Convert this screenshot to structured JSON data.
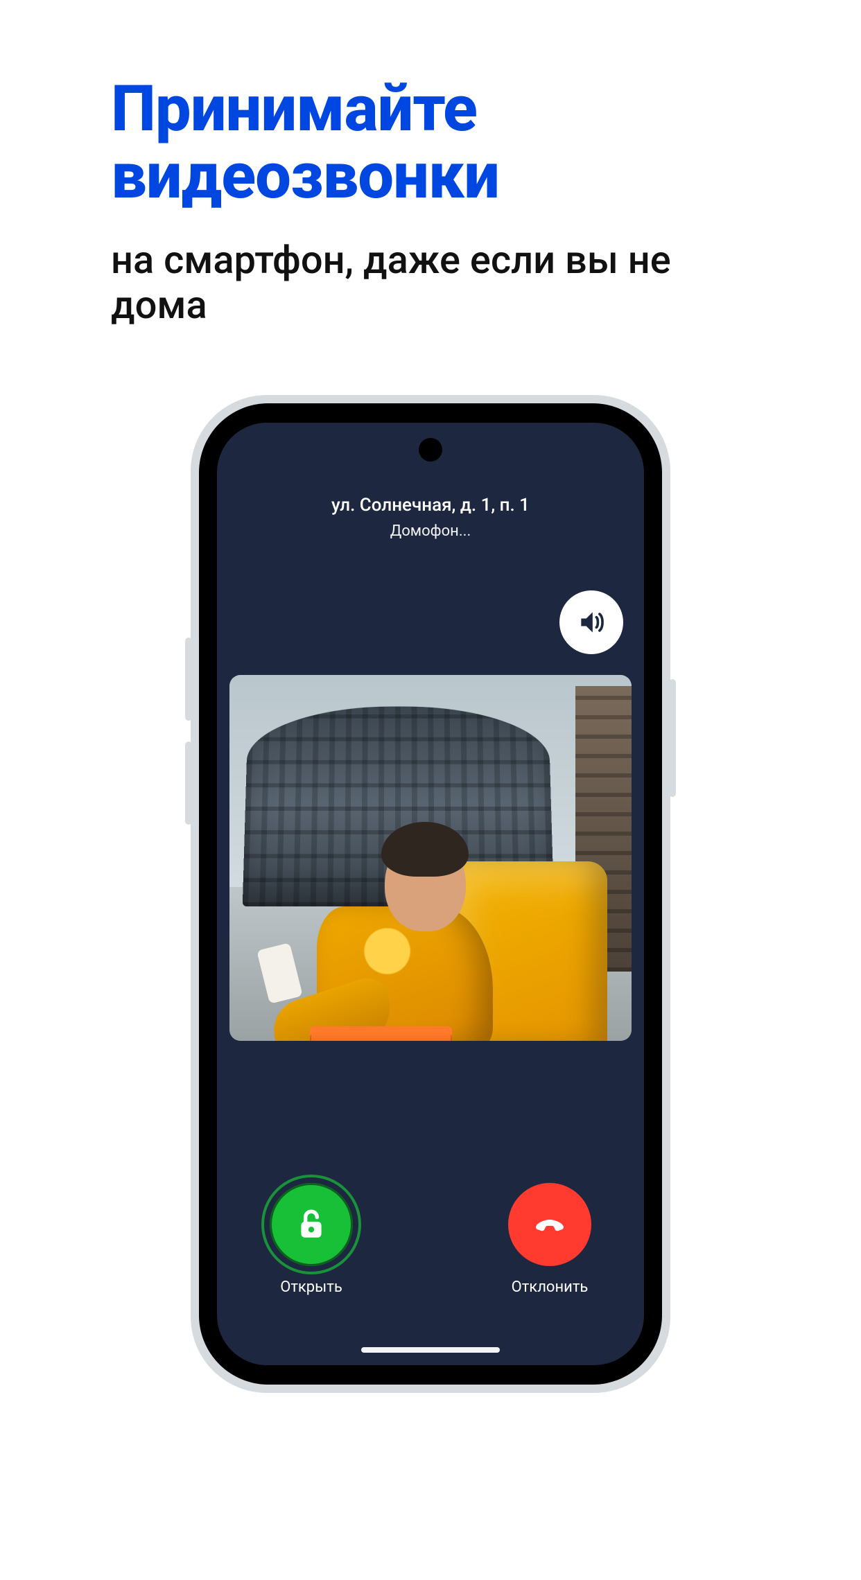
{
  "headline": {
    "title": "Принимайте видеозвонки",
    "subtitle": "на смартфон, даже если вы не дома"
  },
  "call": {
    "address": "ул. Солнечная, д. 1, п. 1",
    "status": "Домофон..."
  },
  "actions": {
    "open": "Открыть",
    "decline": "Отклонить"
  },
  "colors": {
    "accent": "#0047e1",
    "screen_bg": "#1d2740",
    "open_btn": "#18c038",
    "decline_btn": "#ff3b30"
  }
}
